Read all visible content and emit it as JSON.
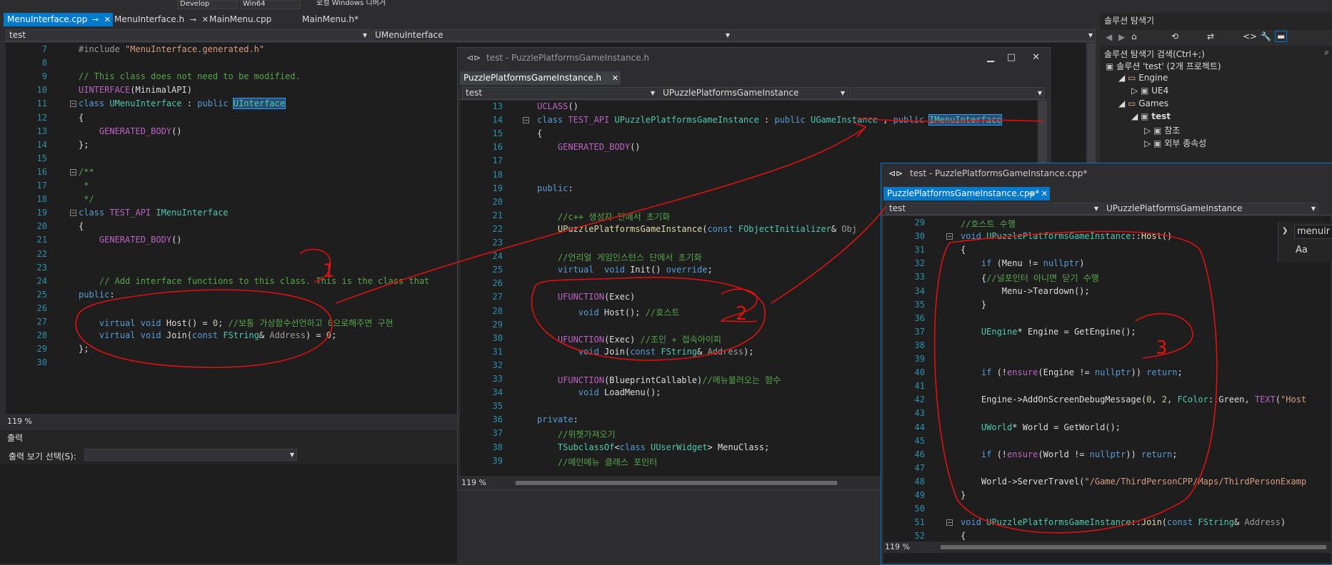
{
  "toolbar": {
    "config_combo": "Develop",
    "platform_combo": "Win64",
    "run_label": "로컬 Windows 디버거"
  },
  "main_editor": {
    "tabs": [
      {
        "label": "MenuInterface.cpp",
        "pin": "⊸",
        "close": "✕",
        "active": true
      },
      {
        "label": "MenuInterface.h",
        "pin": "⊸",
        "close": "✕",
        "active": false
      },
      {
        "label": "MainMenu.cpp",
        "active": false
      },
      {
        "label": "MainMenu.h*",
        "active": false
      }
    ],
    "nav_project": "test",
    "nav_scope": "UMenuInterface",
    "zoom": "119 %",
    "lines": [
      {
        "n": "7",
        "html": "<span class='pp'>#include </span><span class='st'>\"MenuInterface.generated.h\"</span>"
      },
      {
        "n": "8",
        "html": ""
      },
      {
        "n": "9",
        "html": "<span class='cm'>// This class does not need to be modified.</span>"
      },
      {
        "n": "10",
        "html": "<span class='mc'>UINTERFACE</span>(MinimalAPI)"
      },
      {
        "n": "11",
        "html": "<span class='kw'>class</span> <span class='ty'>UMenuInterface</span> : <span class='kw'>public</span> <span class='ty hl'>UInterface</span>"
      },
      {
        "n": "12",
        "html": "{"
      },
      {
        "n": "13",
        "html": "    <span class='mc'>GENERATED_BODY</span>()"
      },
      {
        "n": "14",
        "html": "};"
      },
      {
        "n": "15",
        "html": ""
      },
      {
        "n": "16",
        "html": "<span class='cm'>/**</span>"
      },
      {
        "n": "17",
        "html": "<span class='cm'> *</span>"
      },
      {
        "n": "18",
        "html": "<span class='cm'> */</span>"
      },
      {
        "n": "19",
        "html": "<span class='kw'>class</span> <span class='mc'>TEST_API</span> <span class='ty'>IMenuInterface</span>"
      },
      {
        "n": "20",
        "html": "{"
      },
      {
        "n": "21",
        "html": "    <span class='mc'>GENERATED_BODY</span>()"
      },
      {
        "n": "22",
        "html": ""
      },
      {
        "n": "23",
        "html": ""
      },
      {
        "n": "24",
        "html": "    <span class='cm'>// Add interface functions to this class. This is the class that</span>"
      },
      {
        "n": "25",
        "html": "<span class='kw'>public</span>:"
      },
      {
        "n": "26",
        "html": ""
      },
      {
        "n": "27",
        "html": "    <span class='kw'>virtual</span> <span class='kw'>void</span> Host() = <span class='num'>0</span>; <span class='cm'>//보통 가상함수선언하고 0으로해주면 구현</span>"
      },
      {
        "n": "28",
        "html": "    <span class='kw'>virtual</span> <span class='kw'>void</span> Join(<span class='kw'>const</span> <span class='ty'>FString</span>& <span class='prm'>Address</span>) = <span class='num'>0</span>;"
      },
      {
        "n": "29",
        "html": "};"
      },
      {
        "n": "30",
        "html": ""
      }
    ]
  },
  "header_window": {
    "title": "test - PuzzlePlatformsGameInstance.h",
    "tab": "PuzzlePlatformsGameInstance.h",
    "nav_project": "test",
    "nav_scope": "UPuzzlePlatformsGameInstance",
    "zoom": "119 %",
    "lines": [
      {
        "n": "13",
        "html": "<span class='mc'>UCLASS</span>()"
      },
      {
        "n": "14",
        "html": "<span class='kw'>class</span> <span class='mc'>TEST_API</span> <span class='ty'>UPuzzlePlatformsGameInstance</span> : <span class='kw'>public</span> <span class='ty'>UGameInstance</span> , <span class='kw'>public</span> <span class='ty hl'>IMenuInterface</span>"
      },
      {
        "n": "15",
        "html": "{"
      },
      {
        "n": "16",
        "html": "    <span class='mc'>GENERATED_BODY</span>()"
      },
      {
        "n": "17",
        "html": ""
      },
      {
        "n": "18",
        "html": ""
      },
      {
        "n": "19",
        "html": "<span class='kw'>public</span>:"
      },
      {
        "n": "20",
        "html": ""
      },
      {
        "n": "21",
        "html": "    <span class='cm'>//c++ 생성자 단에서 초기화</span>"
      },
      {
        "n": "22",
        "html": "    <span class='fn'>UPuzzlePlatformsGameInstance</span>(<span class='kw'>const</span> <span class='ty'>FObjectInitializer</span>& <span class='prm'>Obj</span>"
      },
      {
        "n": "23",
        "html": ""
      },
      {
        "n": "24",
        "html": "    <span class='cm'>//언리얼 게임인스턴스 단에서 초기화</span>"
      },
      {
        "n": "25",
        "html": "    <span class='kw'>virtual</span>  <span class='kw'>void</span> Init() <span class='kw'>override</span>;"
      },
      {
        "n": "26",
        "html": ""
      },
      {
        "n": "27",
        "html": "    <span class='mc'>UFUNCTION</span>(Exec)"
      },
      {
        "n": "28",
        "html": "        <span class='kw'>void</span> Host(); <span class='cm'>//호스트</span>"
      },
      {
        "n": "29",
        "html": ""
      },
      {
        "n": "30",
        "html": "    <span class='mc'>UFUNCTION</span>(Exec) <span class='cm'>//조인 + 접속아이피</span>"
      },
      {
        "n": "31",
        "html": "        <span class='kw'>void</span> Join(<span class='kw'>const</span> <span class='ty'>FString</span>& <span class='prm'>Address</span>);"
      },
      {
        "n": "32",
        "html": ""
      },
      {
        "n": "33",
        "html": "    <span class='mc'>UFUNCTION</span>(BlueprintCallable)<span class='cm'>//메뉴불러오는 함수</span>"
      },
      {
        "n": "34",
        "html": "        <span class='kw'>void</span> LoadMenu();"
      },
      {
        "n": "35",
        "html": ""
      },
      {
        "n": "36",
        "html": "<span class='kw'>private</span>:"
      },
      {
        "n": "37",
        "html": "    <span class='cm'>//위젯가져오기</span>"
      },
      {
        "n": "38",
        "html": "    <span class='ty'>TSubclassOf</span>&lt;<span class='kw'>class</span> <span class='ty'>UUserWidget</span>&gt; MenuClass;"
      },
      {
        "n": "39",
        "html": "    <span class='cm'>//메인메뉴 클래스 포인터</span>"
      }
    ]
  },
  "cpp_window": {
    "title": "test - PuzzlePlatformsGameInstance.cpp*",
    "tab": "PuzzlePlatformsGameInstance.cpp*",
    "nav_project": "test",
    "nav_scope": "UPuzzlePlatformsGameInstance",
    "zoom": "119 %",
    "find_text": "menuir",
    "find_case": "Aa",
    "lines": [
      {
        "n": "29",
        "html": "<span class='cm'>//호스트 수행</span>"
      },
      {
        "n": "30",
        "html": "<span class='kw'>void</span> <span class='ty'>UPuzzlePlatformsGameInstance</span>::<span class='fn'>Host</span>()"
      },
      {
        "n": "31",
        "html": "{"
      },
      {
        "n": "32",
        "html": "    <span class='kw'>if</span> (Menu != <span class='kw'>nullptr</span>)"
      },
      {
        "n": "33",
        "html": "    {<span class='cm'>//널포인터 아니면 닫기 수행</span>"
      },
      {
        "n": "34",
        "html": "        Menu-&gt;Teardown();"
      },
      {
        "n": "35",
        "html": "    }"
      },
      {
        "n": "36",
        "html": ""
      },
      {
        "n": "37",
        "html": "    <span class='ty'>UEngine</span>* Engine = GetEngine();"
      },
      {
        "n": "38",
        "html": ""
      },
      {
        "n": "39",
        "html": ""
      },
      {
        "n": "40",
        "html": "    <span class='kw'>if</span> (!<span class='mc'>ensure</span>(Engine != <span class='kw'>nullptr</span>)) <span class='kw'>return</span>;"
      },
      {
        "n": "41",
        "html": ""
      },
      {
        "n": "42",
        "html": "    Engine-&gt;AddOnScreenDebugMessage(<span class='num'>0</span>, <span class='num'>2</span>, <span class='ty'>FColor</span>::Green, <span class='mc'>TEXT</span>(<span class='st'>\"Host</span>"
      },
      {
        "n": "43",
        "html": ""
      },
      {
        "n": "44",
        "html": "    <span class='ty'>UWorld</span>* World = GetWorld();"
      },
      {
        "n": "45",
        "html": ""
      },
      {
        "n": "46",
        "html": "    <span class='kw'>if</span> (!<span class='mc'>ensure</span>(World != <span class='kw'>nullptr</span>)) <span class='kw'>return</span>;"
      },
      {
        "n": "47",
        "html": ""
      },
      {
        "n": "48",
        "html": "    World-&gt;ServerTravel(<span class='st'>\"/Game/ThirdPersonCPP/Maps/ThirdPersonExamp</span>"
      },
      {
        "n": "49",
        "html": "}"
      },
      {
        "n": "50",
        "html": ""
      },
      {
        "n": "51",
        "html": "<span class='kw'>void</span> <span class='ty'>UPuzzlePlatformsGameInstance</span>::<span class='fn'>Join</span>(<span class='kw'>const</span> <span class='ty'>FString</span>& <span class='prm'>Address</span>)"
      },
      {
        "n": "52",
        "html": "{"
      }
    ]
  },
  "solution_explorer": {
    "title": "솔루션 탐색기",
    "search_placeholder": "솔루션 탐색기 검색(Ctrl+;)",
    "items": [
      {
        "label": "솔루션 'test' (2개 프로젝트)",
        "indent": 0
      },
      {
        "label": "Engine",
        "indent": 1
      },
      {
        "label": "UE4",
        "indent": 2
      },
      {
        "label": "Games",
        "indent": 1
      },
      {
        "label": "test",
        "indent": 2
      },
      {
        "label": "참조",
        "indent": 3
      },
      {
        "label": "외부 종속성",
        "indent": 3
      }
    ]
  },
  "output": {
    "title": "출력",
    "source_label": "출력 보기 선택(S):"
  },
  "annotations": [
    "1",
    "2",
    "3"
  ],
  "colors": {
    "accent": "#007acc",
    "editor_bg": "#1e1e1e",
    "marker": "#e01010"
  }
}
